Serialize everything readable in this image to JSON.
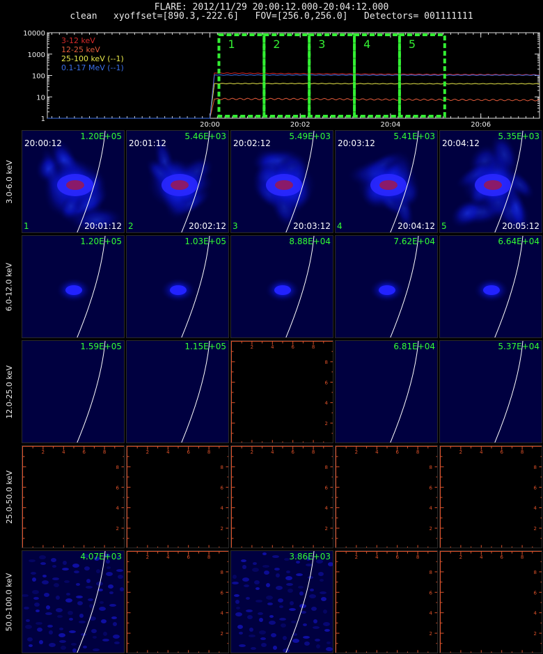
{
  "header": {
    "line1": "FLARE: 2012/11/29 20:00:12.000-20:04:12.000",
    "line2": "clean   xyoffset=[890.3,-222.6]   FOV=[256.0,256.0]   Detectors= 001111111"
  },
  "lightcurve": {
    "legend": [
      {
        "label": "3-12 keV",
        "color": "#d62828"
      },
      {
        "label": "12-25 keV",
        "color": "#e05a3a"
      },
      {
        "label": "25-100 keV (--1)",
        "color": "#e8e84a"
      },
      {
        "label": "0.1-17 MeV (--1)",
        "color": "#3a6fe8"
      }
    ],
    "y_ticks": [
      "1",
      "10",
      "100",
      "1000",
      "10000"
    ],
    "x_ticks": [
      "20:00",
      "20:02",
      "20:04",
      "20:06"
    ],
    "interval_labels": [
      "1",
      "2",
      "3",
      "4",
      "5"
    ],
    "box_color": "#33ee33",
    "chart_data": {
      "type": "line",
      "yscale": "log",
      "ylim": [
        1,
        10000
      ],
      "xlim_minutes_after_2000": [
        -3.6,
        7.3
      ],
      "series": [
        {
          "name": "3-12 keV",
          "x": [
            -3.6,
            0.0,
            0.1,
            2.0,
            4.0,
            7.3
          ],
          "values": [
            1,
            1,
            130,
            122,
            115,
            108
          ]
        },
        {
          "name": "12-25 keV",
          "x": [
            -3.6,
            0.0,
            0.1,
            2.0,
            4.0,
            7.3
          ],
          "values": [
            1,
            1,
            8,
            8,
            7.5,
            7
          ]
        },
        {
          "name": "25-100 keV (--1)",
          "x": [
            -3.6,
            0.0,
            0.1,
            2.0,
            4.0,
            7.3
          ],
          "values": [
            1,
            1,
            42,
            42,
            41,
            41
          ]
        },
        {
          "name": "0.1-17 MeV (--1)",
          "x": [
            -3.6,
            0.0,
            0.1,
            2.0,
            4.0,
            7.3
          ],
          "values": [
            1,
            1,
            105,
            105,
            104,
            104
          ]
        }
      ],
      "intervals_minutes_after_2000": [
        [
          0.2,
          1.2
        ],
        [
          1.2,
          2.2
        ],
        [
          2.2,
          3.2
        ],
        [
          3.2,
          4.2
        ],
        [
          4.2,
          5.2
        ]
      ]
    }
  },
  "rows": [
    {
      "label": "3.0-6.0 keV",
      "panels": [
        {
          "type": "image",
          "peak": "1.20E+05",
          "start": "20:00:12",
          "end": "20:01:12",
          "index": "1",
          "diffuse": 0.9
        },
        {
          "type": "image",
          "peak": "5.46E+03",
          "start": "20:01:12",
          "end": "20:02:12",
          "index": "2",
          "diffuse": 0.6
        },
        {
          "type": "image",
          "peak": "5.49E+03",
          "start": "20:02:12",
          "end": "20:03:12",
          "index": "3",
          "diffuse": 0.6
        },
        {
          "type": "image",
          "peak": "5.41E+03",
          "start": "20:03:12",
          "end": "20:04:12",
          "index": "4",
          "diffuse": 0.6
        },
        {
          "type": "image",
          "peak": "5.35E+03",
          "start": "20:04:12",
          "end": "20:05:12",
          "index": "5",
          "diffuse": 0.9
        }
      ]
    },
    {
      "label": "6.0-12.0 keV",
      "panels": [
        {
          "type": "image",
          "peak": "1.20E+05",
          "diffuse": 0.25
        },
        {
          "type": "image",
          "peak": "1.03E+05",
          "diffuse": 0.2
        },
        {
          "type": "image",
          "peak": "8.88E+04",
          "diffuse": 0.2
        },
        {
          "type": "image",
          "peak": "7.62E+04",
          "diffuse": 0.2
        },
        {
          "type": "image",
          "peak": "6.64E+04",
          "diffuse": 0.2
        }
      ]
    },
    {
      "label": "12.0-25.0 keV",
      "panels": [
        {
          "type": "image",
          "peak": "1.59E+05",
          "faint": true
        },
        {
          "type": "image",
          "peak": "1.15E+05",
          "faint": true
        },
        {
          "type": "empty"
        },
        {
          "type": "image",
          "peak": "6.81E+04",
          "faint": true
        },
        {
          "type": "image",
          "peak": "5.37E+04",
          "faint": true
        }
      ]
    },
    {
      "label": "25.0-50.0 keV",
      "panels": [
        {
          "type": "empty"
        },
        {
          "type": "empty"
        },
        {
          "type": "empty"
        },
        {
          "type": "empty"
        },
        {
          "type": "empty"
        }
      ]
    },
    {
      "label": "50.0-100.0 keV",
      "panels": [
        {
          "type": "image",
          "peak": "4.07E+03",
          "noise": true
        },
        {
          "type": "empty"
        },
        {
          "type": "image",
          "peak": "3.86E+03",
          "noise": true
        },
        {
          "type": "empty"
        },
        {
          "type": "empty"
        }
      ]
    }
  ],
  "empty_axis_ticks": [
    "2",
    "4",
    "6",
    "8"
  ],
  "axis_color": "#e0522a"
}
